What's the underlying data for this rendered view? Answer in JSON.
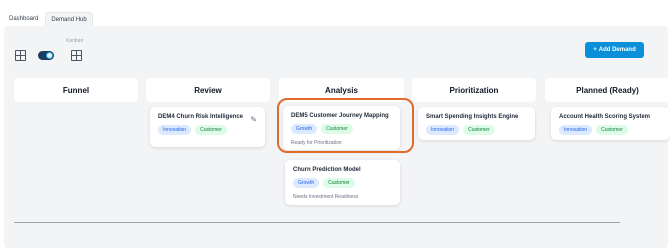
{
  "tabs": [
    {
      "label": "Dashboard",
      "active": false
    },
    {
      "label": "Demand Hub",
      "active": true
    }
  ],
  "toolbar": {
    "kanban_label": "Kanban",
    "toggle_on": true
  },
  "add_button": {
    "icon": "+",
    "label": "Add Demand"
  },
  "columns": [
    {
      "title": "Funnel"
    },
    {
      "title": "Review"
    },
    {
      "title": "Analysis"
    },
    {
      "title": "Prioritization"
    },
    {
      "title": "Planned (Ready)"
    }
  ],
  "cards": {
    "dem4": {
      "title": "DEM4  Churn Risk Intelligence",
      "tags": [
        "Innovation",
        "Customer"
      ],
      "edit_icon": "✎"
    },
    "dem5": {
      "title": "DEM5  Customer Journey Mapping",
      "tags": [
        "Growth",
        "Customer"
      ],
      "status": "Ready for Prioritization"
    },
    "churn": {
      "title": "Churn Prediction Model",
      "tags": [
        "Growth",
        "Customer"
      ],
      "status": "Needs Investment Readiness"
    },
    "smart": {
      "title": "Smart Spending Insights Engine",
      "tags": [
        "Innovation",
        "Customer"
      ]
    },
    "account": {
      "title": "Account Health Scoring System",
      "tags": [
        "Innovation",
        "Customer"
      ]
    }
  },
  "colors": {
    "accent": "#0b8fd9",
    "highlight": "#e06a2c",
    "toggle": "#1e3a5f"
  }
}
